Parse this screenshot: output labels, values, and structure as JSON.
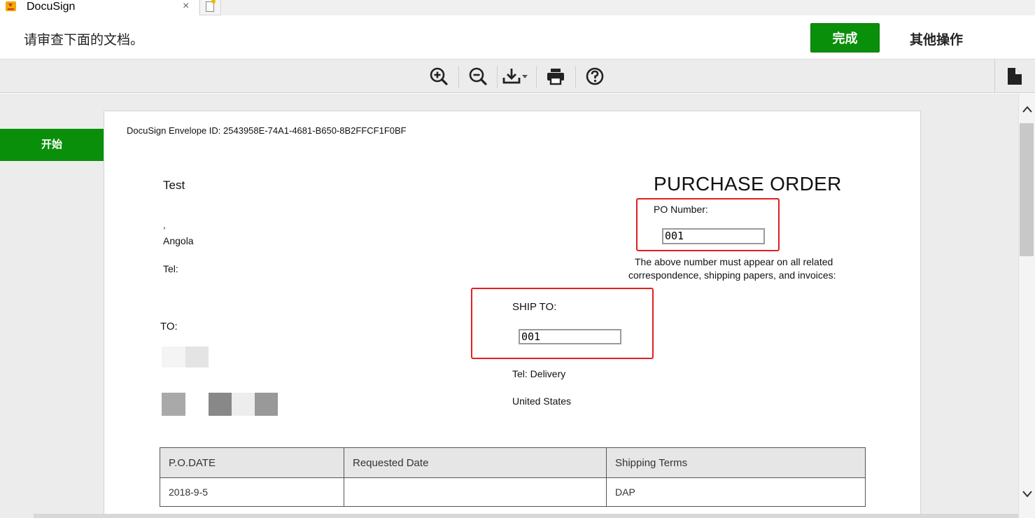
{
  "browser": {
    "tab_title": "DocuSign",
    "tab_close": "×"
  },
  "header": {
    "message": "请审查下面的文档。",
    "finish_label": "完成",
    "other_actions_label": "其他操作"
  },
  "toolbar": {
    "icons": [
      "zoom-in-icon",
      "zoom-out-icon",
      "download-icon",
      "print-icon",
      "help-icon",
      "document-icon"
    ]
  },
  "sidebar": {
    "start_label": "开始"
  },
  "document": {
    "envelope_id": "DocuSign Envelope ID: 2543958E-74A1-4681-B650-8B2FFCF1F0BF",
    "company": "Test",
    "comma": ",",
    "country": "Angola",
    "tel": "Tel:",
    "to_label": "TO:",
    "title": "PURCHASE ORDER",
    "po_number_label": "PO Number:",
    "po_number_value": "001",
    "notice_line1": "The above number must appear on all related",
    "notice_line2": "correspondence, shipping papers, and invoices:",
    "ship_to_label": "SHIP TO:",
    "ship_to_value": "001",
    "ship_tel": "Tel: Delivery",
    "ship_country": "United States",
    "table": {
      "headers": [
        "P.O.DATE",
        "Requested Date",
        "Shipping Terms"
      ],
      "rows": [
        [
          "2018-9-5",
          "",
          "DAP"
        ]
      ]
    }
  },
  "colors": {
    "accent_green": "#0a8f0a",
    "highlight_red": "#e02020"
  }
}
